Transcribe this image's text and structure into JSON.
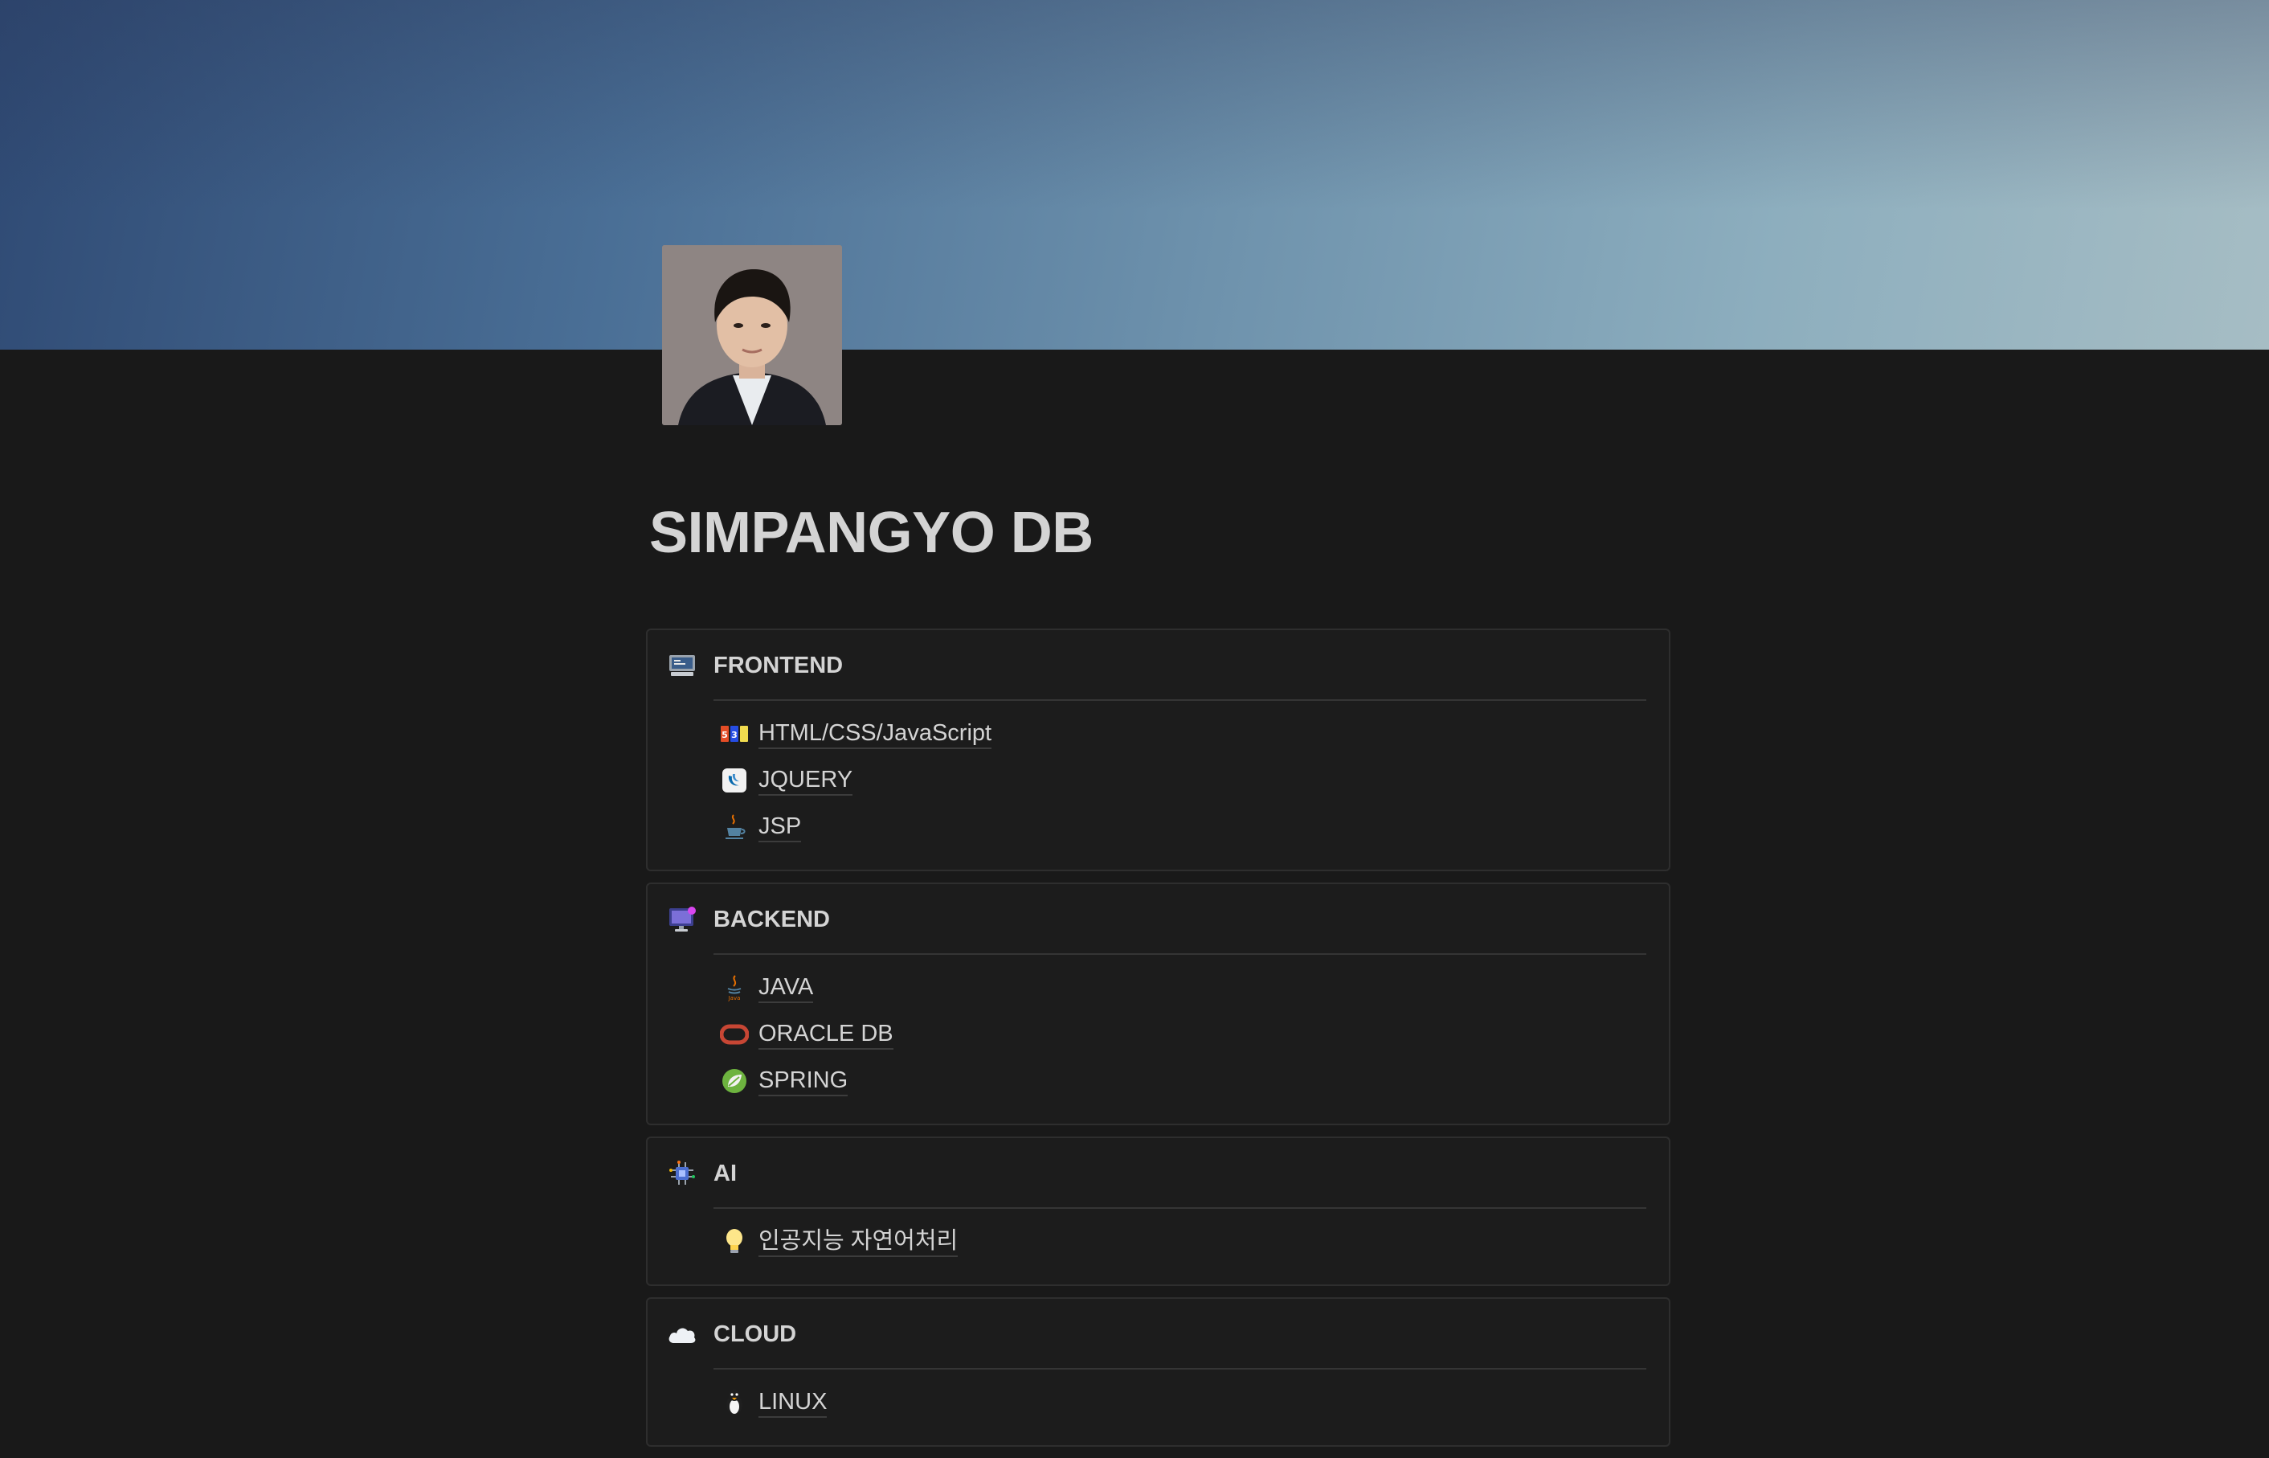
{
  "page": {
    "title": "SIMPANGYO DB"
  },
  "sections": [
    {
      "title": "FRONTEND",
      "icon": "computer-icon",
      "items": [
        {
          "label": "HTML/CSS/JavaScript",
          "icon": "html-css-js-icon"
        },
        {
          "label": "JQUERY",
          "icon": "jquery-icon"
        },
        {
          "label": "JSP",
          "icon": "java-cup-icon"
        }
      ]
    },
    {
      "title": "BACKEND",
      "icon": "monitor-icon",
      "items": [
        {
          "label": "JAVA",
          "icon": "java-icon"
        },
        {
          "label": "ORACLE DB",
          "icon": "oracle-icon"
        },
        {
          "label": "SPRING",
          "icon": "spring-leaf-icon"
        }
      ]
    },
    {
      "title": "AI",
      "icon": "chip-icon",
      "items": [
        {
          "label": "인공지능 자연어처리",
          "icon": "lightbulb-icon"
        }
      ]
    },
    {
      "title": "CLOUD",
      "icon": "cloud-icon",
      "items": [
        {
          "label": "LINUX",
          "icon": "penguin-icon"
        }
      ]
    }
  ],
  "colors": {
    "background": "#191919",
    "text": "#d4d4d4",
    "border": "#2e2e2e",
    "cover_start": "#2f4a74",
    "cover_end": "#a6bdc4"
  }
}
